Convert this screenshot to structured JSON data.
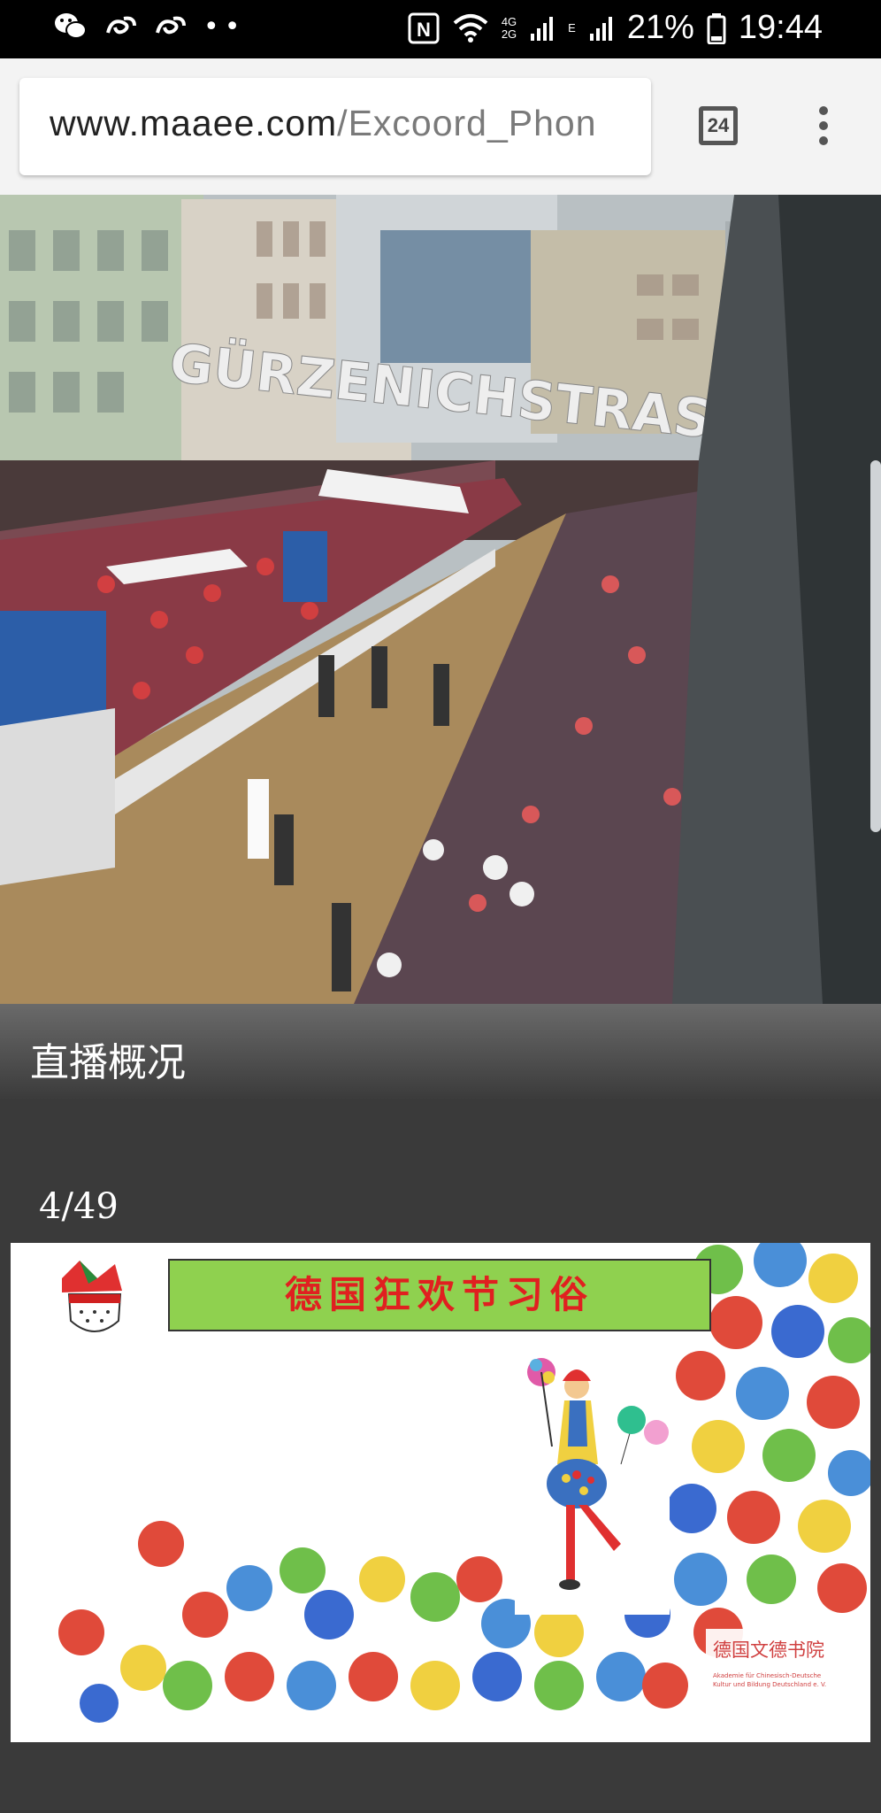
{
  "status_bar": {
    "time": "19:44",
    "battery_pct": "21%",
    "net_top": "4G",
    "net_bottom": "2G",
    "net_e": "E",
    "notification_icons": [
      "wechat-icon",
      "swirl-icon",
      "swirl-icon",
      "more-dots-icon"
    ],
    "system_icons": [
      "nfc-icon",
      "wifi-icon",
      "signal-icon",
      "signal-icon",
      "battery-icon"
    ]
  },
  "browser": {
    "url_domain": "www.maaee.com",
    "url_path": "/Excoord_Phon",
    "tab_count": "24",
    "menu_icon": "overflow-menu-icon"
  },
  "video": {
    "sign_text": "GÜRZENICHSTRASSE"
  },
  "section": {
    "title": "直播概况"
  },
  "slides": {
    "counter": "4/49",
    "current": 4,
    "total": 49,
    "title": "德国狂欢节习俗",
    "org_name": "德国文德书院",
    "org_subtitle": "Akademie für Chinesisch-Deutsche Kultur und Bildung Deutschland e. V."
  },
  "colors": {
    "title_bg": "#8fd14f",
    "title_text": "#e02020",
    "panel_bg": "#3a3a3a"
  }
}
